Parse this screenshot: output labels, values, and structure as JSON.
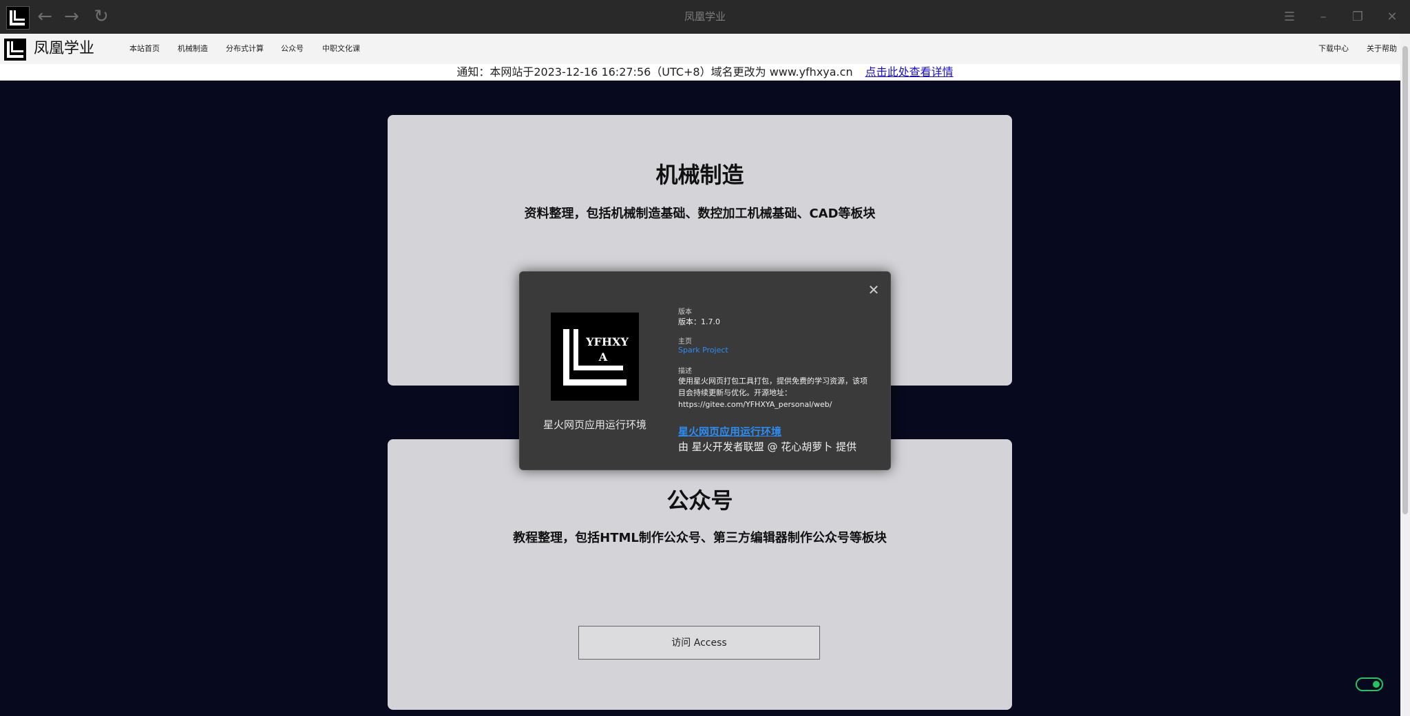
{
  "window": {
    "title": "凤凰学业",
    "nav_icons": [
      "back-arrow-icon",
      "forward-arrow-icon",
      "reload-icon"
    ],
    "controls": [
      "menu-icon",
      "minimize-icon",
      "restore-icon",
      "close-icon"
    ]
  },
  "site": {
    "brand": "凤凰学业",
    "nav_left": [
      "本站首页",
      "机械制造",
      "分布式计算",
      "公众号",
      "中职文化课"
    ],
    "nav_right": [
      "下载中心",
      "关于帮助"
    ]
  },
  "notice": {
    "text": "通知：本网站于2023-12-16 16:27:56（UTC+8）域名更改为 www.yfhxya.cn",
    "link": "点击此处查看详情"
  },
  "cards": [
    {
      "title": "机械制造",
      "desc": "资料整理，包括机械制造基础、数控加工机械基础、CAD等板块"
    },
    {
      "title": "公众号",
      "desc": "教程整理，包括HTML制作公众号、第三方编辑器制作公众号等板块",
      "button": "访问 Access"
    }
  ],
  "about_dialog": {
    "logo_text": "YFHXYA",
    "app_name": "星火网页应用运行环境",
    "version_label": "版本",
    "version_value": "版本：1.7.0",
    "homepage_label": "主页",
    "homepage_link": "Spark Project",
    "desc_label": "描述",
    "desc_text": "使用星火网页打包工具打包，提供免费的学习资源，该项目会持续更新与优化。开源地址：https://gitee.com/YFHXYA_personal/web/",
    "runtime_link": "星火网页应用运行环境",
    "credit": "由 星火开发者联盟 @ 花心胡萝卜 提供"
  },
  "colors": {
    "page_bg": "#070a1f",
    "card_bg": "#d4d4d8",
    "dialog_bg": "#3a3a3a",
    "link_blue": "#2d8cf0",
    "toggle_green": "#22c55e"
  }
}
